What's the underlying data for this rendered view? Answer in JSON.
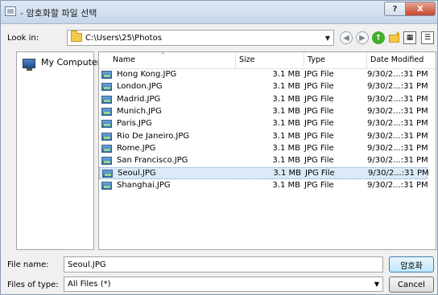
{
  "window": {
    "title": "- 암호화할 파일 선택"
  },
  "lookin": {
    "label": "Look in:",
    "path": "C:\\Users\\25\\Photos"
  },
  "places": [
    {
      "label": "My Computer",
      "icon": "computer-icon"
    }
  ],
  "columns": [
    "Name",
    "Size",
    "Type",
    "Date Modified"
  ],
  "files": [
    {
      "name": "Hong Kong.JPG",
      "size": "3.1 MB",
      "type": "JPG File",
      "date": "9/30/2...:31 PM"
    },
    {
      "name": "London.JPG",
      "size": "3.1 MB",
      "type": "JPG File",
      "date": "9/30/2...:31 PM"
    },
    {
      "name": "Madrid.JPG",
      "size": "3.1 MB",
      "type": "JPG File",
      "date": "9/30/2...:31 PM"
    },
    {
      "name": "Munich.JPG",
      "size": "3.1 MB",
      "type": "JPG File",
      "date": "9/30/2...:31 PM"
    },
    {
      "name": "Paris.JPG",
      "size": "3.1 MB",
      "type": "JPG File",
      "date": "9/30/2...:31 PM"
    },
    {
      "name": "Rio De Janeiro.JPG",
      "size": "3.1 MB",
      "type": "JPG File",
      "date": "9/30/2...:31 PM"
    },
    {
      "name": "Rome.JPG",
      "size": "3.1 MB",
      "type": "JPG File",
      "date": "9/30/2...:31 PM"
    },
    {
      "name": "San Francisco.JPG",
      "size": "3.1 MB",
      "type": "JPG File",
      "date": "9/30/2...:31 PM"
    },
    {
      "name": "Seoul.JPG",
      "size": "3.1 MB",
      "type": "JPG File",
      "date": "9/30/2...:31 PM",
      "selected": true
    },
    {
      "name": "Shanghai.JPG",
      "size": "3.1 MB",
      "type": "JPG File",
      "date": "9/30/2...:31 PM"
    }
  ],
  "filename": {
    "label": "File name:",
    "value": "Seoul.JPG"
  },
  "filetype": {
    "label": "Files of type:",
    "value": "All Files (*)"
  },
  "buttons": {
    "primary": "암호화",
    "cancel": "Cancel",
    "help": "?",
    "close": "X"
  },
  "colors": {
    "selection": "#dceaf8",
    "close": "#c7462d"
  }
}
